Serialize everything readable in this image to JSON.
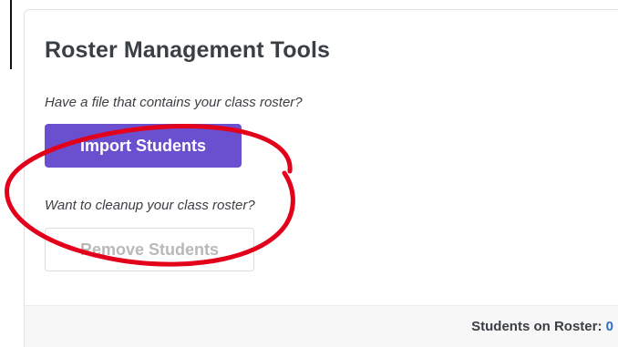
{
  "card": {
    "title": "Roster Management Tools",
    "import_prompt": "Have a file that contains your class roster?",
    "import_button": "Import Students",
    "remove_prompt": "Want to cleanup your class roster?",
    "remove_button": "Remove Students"
  },
  "footer": {
    "label": "Students on Roster:",
    "count": "0"
  },
  "colors": {
    "primary_button": "#6a4fcf",
    "annotation": "#e3001b",
    "count_link": "#2f6fbd"
  }
}
